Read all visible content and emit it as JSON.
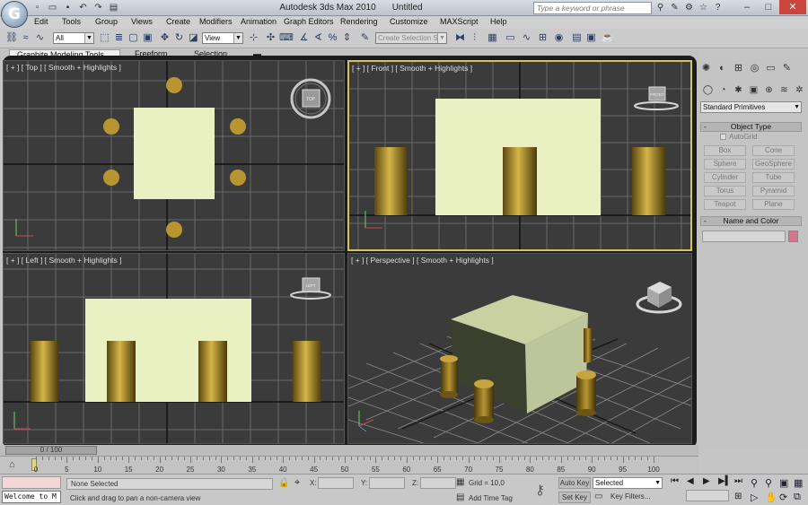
{
  "window": {
    "app_name": "Autodesk 3ds Max  2010",
    "doc_name": "Untitled",
    "search_placeholder": "Type a keyword or phrase"
  },
  "menu": [
    "Edit",
    "Tools",
    "Group",
    "Views",
    "Create",
    "Modifiers",
    "Animation",
    "Graph Editors",
    "Rendering",
    "Customize",
    "MAXScript",
    "Help"
  ],
  "toolbar": {
    "selection_filter": "All",
    "ref_coord": "View",
    "named_selection_placeholder": "Create Selection Se"
  },
  "ribbon": {
    "tabs": [
      "Graphite Modeling Tools",
      "Freeform",
      "Selection"
    ]
  },
  "viewports": {
    "top": "[ + ] [ Top ] [ Smooth + Highlights ]",
    "front": "[ + ] [ Front ] [ Smooth + Highlights ]",
    "left": "[ + ] [ Left ] [ Smooth + Highlights ]",
    "perspective": "[ + ] [ Perspective ] [ Smooth + Highlights ]",
    "cube_labels": {
      "top": "TOP",
      "front": "FRONT",
      "left": "LEFT"
    }
  },
  "command_panel": {
    "category": "Standard Primitives",
    "object_type_title": "Object Type",
    "autogrid": "AutoGrid",
    "primitives": [
      "Box",
      "Cone",
      "Sphere",
      "GeoSphere",
      "Cylinder",
      "Tube",
      "Torus",
      "Pyramid",
      "Teapot",
      "Plane"
    ],
    "name_color_title": "Name and Color",
    "swatch_color": "#d8738c"
  },
  "timeline": {
    "slider_label": "0 / 100",
    "ticks": [
      "0",
      "5",
      "10",
      "15",
      "20",
      "25",
      "30",
      "35",
      "40",
      "45",
      "50",
      "55",
      "60",
      "65",
      "70",
      "75",
      "80",
      "85",
      "90",
      "95",
      "100"
    ]
  },
  "status": {
    "maxscript": "Welcome to M",
    "selection": "None Selected",
    "prompt": "Click and drag to pan a non-camera view",
    "x_label": "X:",
    "y_label": "Y:",
    "z_label": "Z:",
    "grid": "Grid = 10,0",
    "add_time_tag": "Add Time Tag",
    "auto_key": "Auto Key",
    "set_key": "Set Key",
    "key_mode": "Selected",
    "key_filters": "Key Filters..."
  },
  "colors": {
    "table_top": "#e9f1c3",
    "leg_gold": "#b89530",
    "active_border": "#d6c15b"
  }
}
